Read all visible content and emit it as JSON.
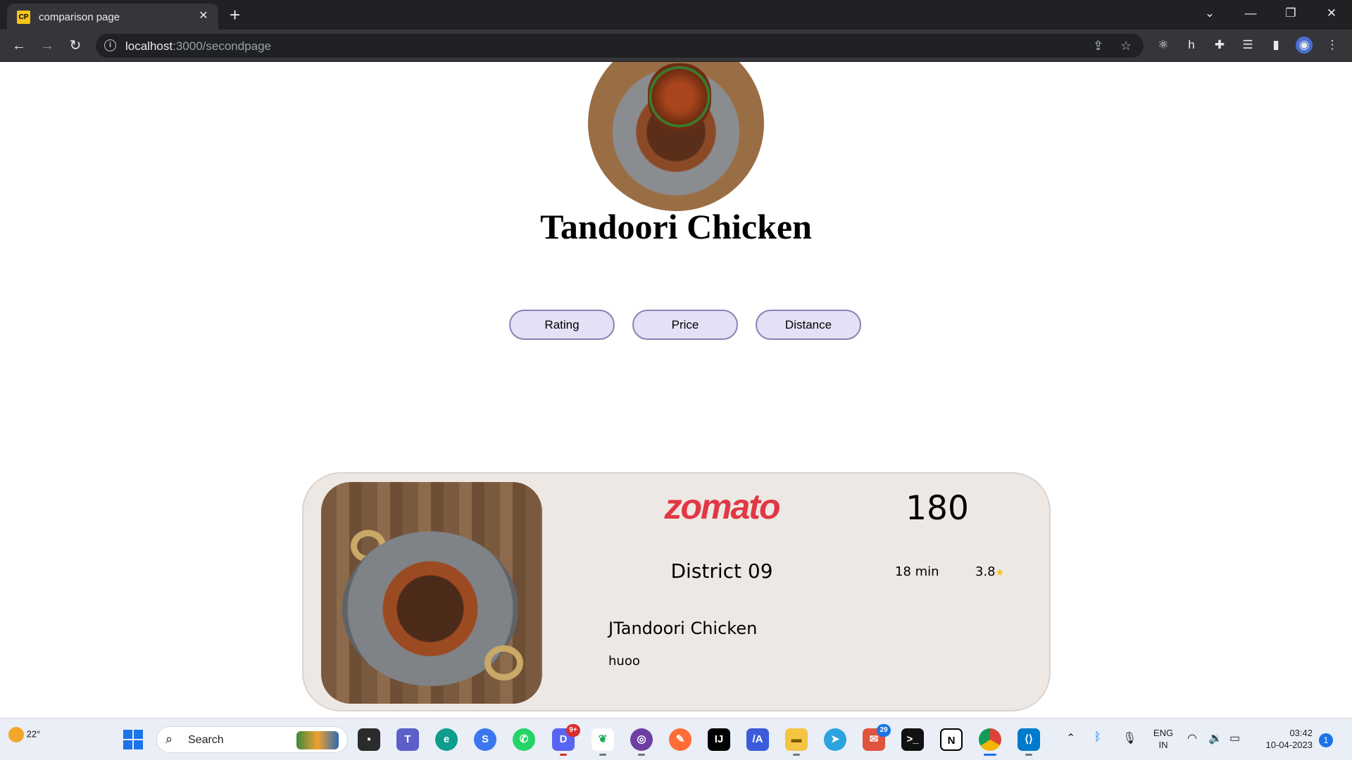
{
  "browser": {
    "tab_title": "comparison page",
    "tab_favicon": "CP",
    "url_host": "localhost",
    "url_path": ":3000/secondpage"
  },
  "page": {
    "dish_title": "Tandoori Chicken",
    "sort_buttons": [
      "Rating",
      "Price",
      "Distance"
    ]
  },
  "card": {
    "brand": "zomato",
    "price": "180",
    "restaurant": "District 09",
    "time": "18 min",
    "rating": "3.8",
    "rating_star": "★",
    "item_name": "JTandoori Chicken",
    "item_desc": "huoo"
  },
  "taskbar": {
    "weather_temp": "22°",
    "search_label": "Search",
    "lang_top": "ENG",
    "lang_bottom": "IN",
    "time": "03:42",
    "date": "10-04-2023",
    "notification_count": "1",
    "discord_badge": "9+",
    "mail_badge": "29",
    "icons": [
      "file-explorer-icon",
      "teams-icon",
      "edge-icon",
      "signal-icon",
      "whatsapp-icon",
      "discord-icon",
      "mongodb-icon",
      "github-icon",
      "postman-icon",
      "intellij-icon",
      "app-icon",
      "folder-icon",
      "telegram-icon",
      "mail-icon",
      "terminal-icon",
      "notion-icon",
      "chrome-icon",
      "vscode-icon"
    ]
  },
  "colors": {
    "brand_red": "#e23744",
    "button_fill": "#e4e0f5",
    "button_border": "#8e80b6",
    "card_bg": "#ede8e4"
  }
}
